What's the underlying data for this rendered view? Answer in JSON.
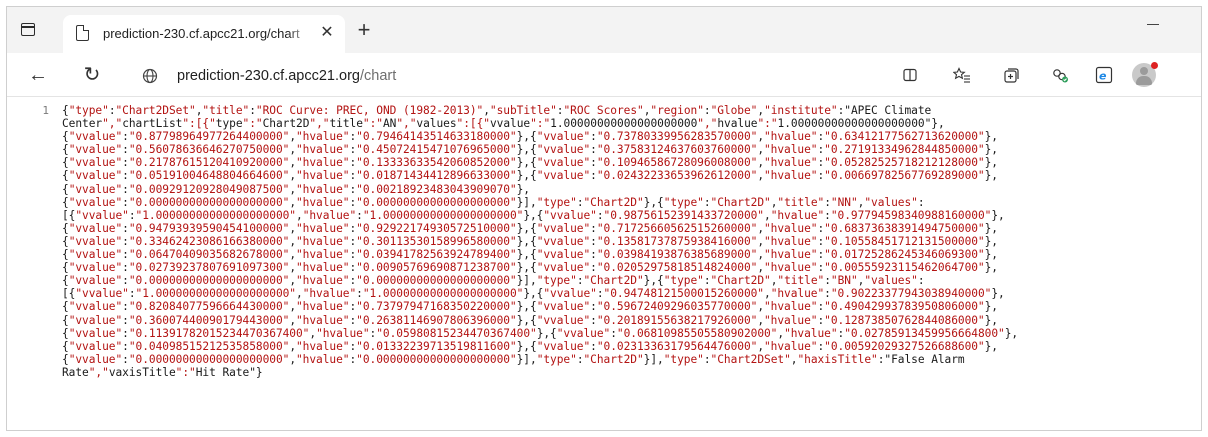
{
  "tab": {
    "title": "prediction-230.cf.apcc21.org/chart",
    "close_glyph": "✕",
    "new_glyph": "+"
  },
  "toolbar": {
    "back_glyph": "←",
    "reload_glyph": "↻",
    "url_host": "prediction-230.cf.apcc21.org",
    "url_path": "/chart"
  },
  "icons": {
    "page": "page-icon",
    "globe": "globe-icon",
    "split": "split-screen-icon",
    "favorites": "favorites-icon",
    "collections": "collections-icon",
    "extensions": "extensions-icon",
    "ie_mode": "ie-mode-icon",
    "profile": "profile-avatar-icon"
  },
  "viewer": {
    "line_number": "1",
    "lines": [
      "{\"type\":\"Chart2DSet\",\"title\":\"ROC Curve: PREC, OND (1982-2013)\",\"subTitle\":\"ROC Scores\",\"region\":\"Globe\",\"institute\":\"APEC Climate",
      "Center\",\"chartList\":[{\"type\":\"Chart2D\",\"title\":\"AN\",\"values\":[{\"vvalue\":\"1.00000000000000000000\",\"hvalue\":\"1.00000000000000000000\"},",
      "{\"vvalue\":\"0.87798964977264400000\",\"hvalue\":\"0.79464143514633180000\"},{\"vvalue\":\"0.73780339956283570000\",\"hvalue\":\"0.63412177562713620000\"},",
      "{\"vvalue\":\"0.56078636646270750000\",\"hvalue\":\"0.45072415471076965000\"},{\"vvalue\":\"0.37583124637603760000\",\"hvalue\":\"0.27191334962844850000\"},",
      "{\"vvalue\":\"0.21787615120410920000\",\"hvalue\":\"0.13333633542060852000\"},{\"vvalue\":\"0.10946586728096008000\",\"hvalue\":\"0.05282525718212128000\"},",
      "{\"vvalue\":\"0.05191004648804664600\",\"hvalue\":\"0.01871434412896633000\"},{\"vvalue\":\"0.02432233653962612000\",\"hvalue\":\"0.00669782567769289000\"},",
      "{\"vvalue\":\"0.00929120928049087500\",\"hvalue\":\"0.00218923483043909070\"},",
      "{\"vvalue\":\"0.00000000000000000000\",\"hvalue\":\"0.00000000000000000000\"}],\"type\":\"Chart2D\"},{\"type\":\"Chart2D\",\"title\":\"NN\",\"values\":",
      "[{\"vvalue\":\"1.00000000000000000000\",\"hvalue\":\"1.00000000000000000000\"},{\"vvalue\":\"0.98756152391433720000\",\"hvalue\":\"0.97794598340988160000\"},",
      "{\"vvalue\":\"0.94793939590454100000\",\"hvalue\":\"0.92922174930572510000\"},{\"vvalue\":\"0.71725660562515260000\",\"hvalue\":\"0.68373638391494750000\"},",
      "{\"vvalue\":\"0.33462423086166380000\",\"hvalue\":\"0.30113530158996580000\"},{\"vvalue\":\"0.13581737875938416000\",\"hvalue\":\"0.10558451712131500000\"},",
      "{\"vvalue\":\"0.06470409035682678000\",\"hvalue\":\"0.03941782563924789400\"},{\"vvalue\":\"0.03984193876385689000\",\"hvalue\":\"0.01725286245346069300\"},",
      "{\"vvalue\":\"0.02739237807691097300\",\"hvalue\":\"0.00905769690871238700\"},{\"vvalue\":\"0.02052975818514824000\",\"hvalue\":\"0.00555923115462064700\"},",
      "{\"vvalue\":\"0.00000000000000000000\",\"hvalue\":\"0.00000000000000000000\"}],\"type\":\"Chart2D\"},{\"type\":\"Chart2D\",\"title\":\"BN\",\"values\":",
      "[{\"vvalue\":\"1.00000000000000000000\",\"hvalue\":\"1.00000000000000000000\"},{\"vvalue\":\"0.94748121500015260000\",\"hvalue\":\"0.90223377943038940000\"},",
      "{\"vvalue\":\"0.82084077596664430000\",\"hvalue\":\"0.73797947168350220000\"},{\"vvalue\":\"0.59672409296035770000\",\"hvalue\":\"0.49042993783950806000\"},",
      "{\"vvalue\":\"0.36007440090179443000\",\"hvalue\":\"0.26381146907806396000\"},{\"vvalue\":\"0.20189155638217926000\",\"hvalue\":\"0.12873850762844086000\"},",
      "{\"vvalue\":\"0.11391782015234470367400\",\"hvalue\":\"0.05980815234470367400\"},{\"vvalue\":\"0.06810985505580902000\",\"hvalue\":\"0.02785913459956664800\"},",
      "{\"vvalue\":\"0.04098515212535858000\",\"hvalue\":\"0.01332239713519811600\"},{\"vvalue\":\"0.02313363179564476000\",\"hvalue\":\"0.00592029327526688600\"},",
      "{\"vvalue\":\"0.00000000000000000000\",\"hvalue\":\"0.00000000000000000000\"}],\"type\":\"Chart2D\"}],\"type\":\"Chart2DSet\",\"haxisTitle\":\"False Alarm",
      "Rate\",\"vaxisTitle\":\"Hit Rate\"}"
    ]
  }
}
